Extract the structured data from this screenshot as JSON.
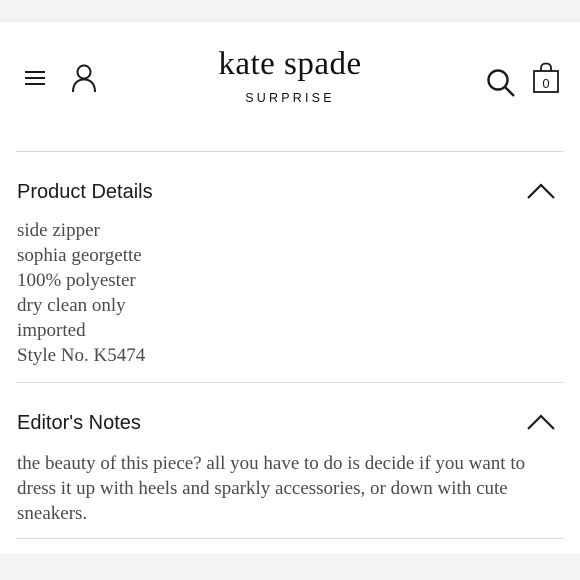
{
  "header": {
    "brand": "kate spade",
    "brand_sub": "SURPRISE",
    "bag_count": "0"
  },
  "icons": {
    "menu": "hamburger-menu-icon",
    "account": "user-icon",
    "search": "search-icon",
    "bag": "shopping-bag-icon",
    "collapse": "chevron-up-icon"
  },
  "product_details": {
    "title": "Product Details",
    "lines": [
      "side zipper",
      "sophia georgette",
      "100% polyester",
      "dry clean only",
      "imported",
      "Style No. K5474"
    ]
  },
  "editors_notes": {
    "title": "Editor's Notes",
    "text": "the beauty of this piece? all you have to do is decide if you want to dress it up with heels and sparkly accessories, or down with cute sneakers."
  },
  "colors": {
    "text": "#1a1a1a",
    "body_text": "#4a4a4a",
    "divider": "#dcdcdc",
    "page_bg": "#f3f3f3"
  }
}
